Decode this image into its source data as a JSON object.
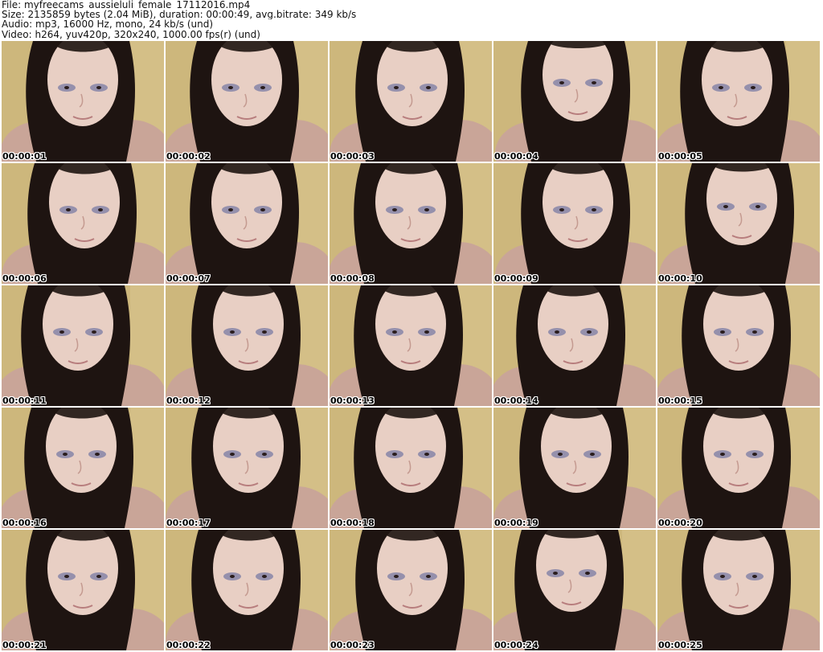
{
  "header": {
    "file": "File: myfreecams_aussieluli_female_17112016.mp4",
    "size": "Size: 2135859 bytes (2.04 MiB), duration: 00:00:49, avg.bitrate: 349 kb/s",
    "audio": "Audio: mp3, 16000 Hz, mono, 24 kb/s (und)",
    "video": "Video: h264, yuv420p, 320x240, 1000.00 fps(r) (und)"
  },
  "frames": [
    {
      "timestamp": "00:00:01"
    },
    {
      "timestamp": "00:00:02"
    },
    {
      "timestamp": "00:00:03"
    },
    {
      "timestamp": "00:00:04"
    },
    {
      "timestamp": "00:00:05"
    },
    {
      "timestamp": "00:00:06"
    },
    {
      "timestamp": "00:00:07"
    },
    {
      "timestamp": "00:00:08"
    },
    {
      "timestamp": "00:00:09"
    },
    {
      "timestamp": "00:00:10"
    },
    {
      "timestamp": "00:00:11"
    },
    {
      "timestamp": "00:00:12"
    },
    {
      "timestamp": "00:00:13"
    },
    {
      "timestamp": "00:00:14"
    },
    {
      "timestamp": "00:00:15"
    },
    {
      "timestamp": "00:00:16"
    },
    {
      "timestamp": "00:00:17"
    },
    {
      "timestamp": "00:00:18"
    },
    {
      "timestamp": "00:00:19"
    },
    {
      "timestamp": "00:00:20"
    },
    {
      "timestamp": "00:00:21"
    },
    {
      "timestamp": "00:00:22"
    },
    {
      "timestamp": "00:00:23"
    },
    {
      "timestamp": "00:00:24"
    },
    {
      "timestamp": "00:00:25"
    }
  ],
  "colors": {
    "wall": "#cdb77c",
    "hair": "#1e1411",
    "skin": "#e8cfc4",
    "shoulder": "#c9a598",
    "timestamp_text": "#000000"
  }
}
